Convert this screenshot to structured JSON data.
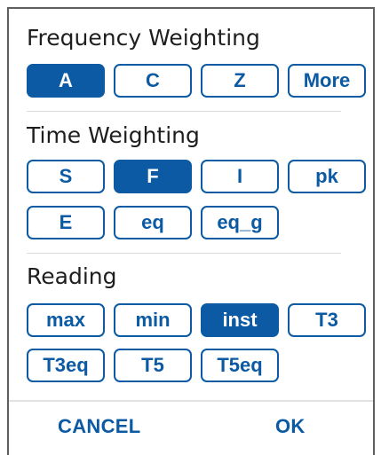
{
  "frequency_weighting": {
    "title": "Frequency Weighting",
    "options": [
      {
        "label": "A",
        "selected": true
      },
      {
        "label": "C",
        "selected": false
      },
      {
        "label": "Z",
        "selected": false
      },
      {
        "label": "More",
        "selected": false
      }
    ]
  },
  "time_weighting": {
    "title": "Time Weighting",
    "options": [
      {
        "label": "S",
        "selected": false
      },
      {
        "label": "F",
        "selected": true
      },
      {
        "label": "I",
        "selected": false
      },
      {
        "label": "pk",
        "selected": false
      },
      {
        "label": "E",
        "selected": false
      },
      {
        "label": "eq",
        "selected": false
      },
      {
        "label": "eq_g",
        "selected": false
      }
    ]
  },
  "reading": {
    "title": "Reading",
    "options": [
      {
        "label": "max",
        "selected": false
      },
      {
        "label": "min",
        "selected": false
      },
      {
        "label": "inst",
        "selected": true
      },
      {
        "label": "T3",
        "selected": false
      },
      {
        "label": "T3eq",
        "selected": false
      },
      {
        "label": "T5",
        "selected": false
      },
      {
        "label": "T5eq",
        "selected": false
      }
    ]
  },
  "actions": {
    "cancel_label": "CANCEL",
    "ok_label": "OK"
  },
  "colors": {
    "accent": "#0b5aa3",
    "selected_text": "#ffffff"
  }
}
